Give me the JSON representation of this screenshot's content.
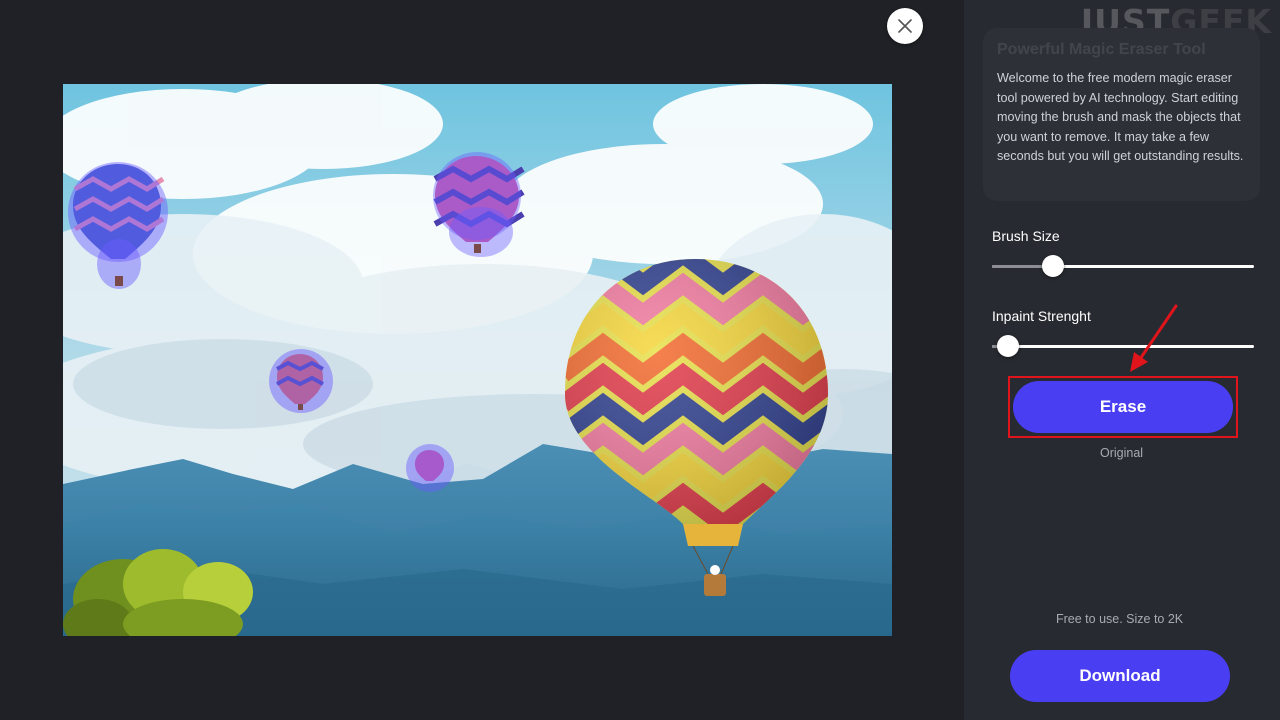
{
  "watermark": {
    "part1": "JUST",
    "part2": "GEEK"
  },
  "info_card": {
    "title": "Powerful Magic Eraser Tool",
    "text": "Welcome to the free modern magic eraser tool powered by AI technology. Start editing moving the brush and mask the objects that you want to remove. It may take a few seconds but you will get outstanding results."
  },
  "controls": {
    "brush_size_label": "Brush Size",
    "brush_size_value": 0.21,
    "inpaint_label": "Inpaint Strenght",
    "inpaint_value": 0.02
  },
  "buttons": {
    "erase_label": "Erase",
    "original_label": "Original",
    "download_label": "Download"
  },
  "footer": {
    "note": "Free to use. Size to 2K"
  },
  "colors": {
    "background": "#1f2126",
    "panel": "#272a30",
    "accent": "#4a3ef2",
    "highlight_red": "#e0141b",
    "mask_overlay": "#6b5cff"
  },
  "icons": {
    "close": "close-icon",
    "arrow": "red-arrow-annotation"
  }
}
